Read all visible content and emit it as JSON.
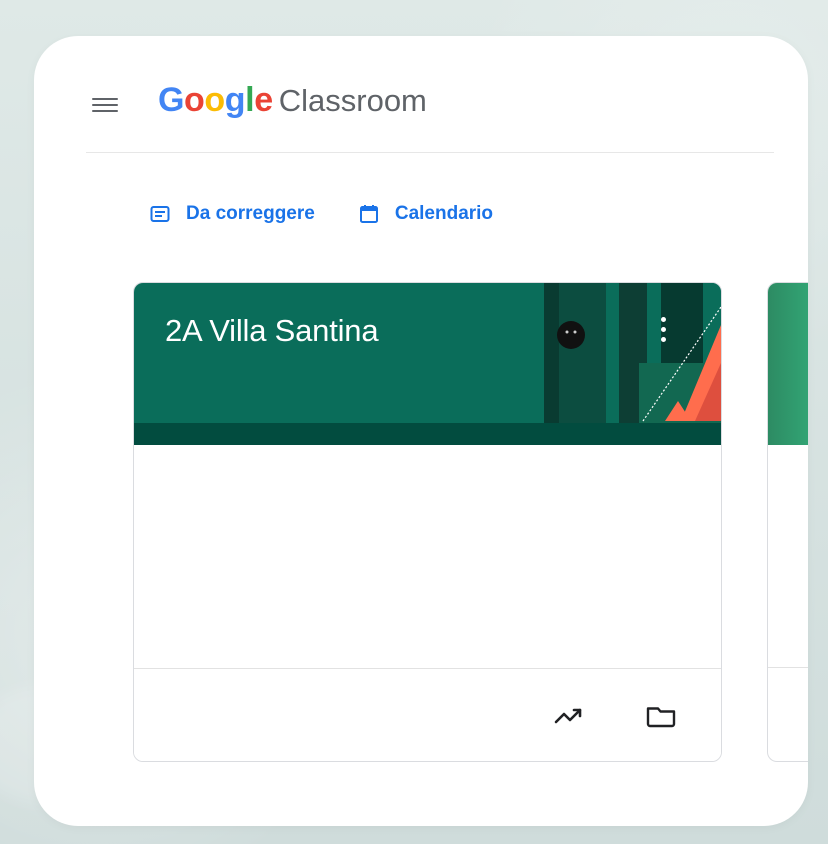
{
  "header": {
    "menu_icon": "menu-icon",
    "brand_google": "Google",
    "brand_product": "Classroom"
  },
  "actions": [
    {
      "label": "Da correggere",
      "icon": "assignment-icon"
    },
    {
      "label": "Calendario",
      "icon": "calendar-icon"
    }
  ],
  "course_card": {
    "title": "2A Villa Santina",
    "menu_icon": "more-vert-icon",
    "footer_icons": [
      "trending-up-icon",
      "folder-icon"
    ]
  },
  "colors": {
    "google_blue": "#4285f4",
    "google_red": "#ea4335",
    "google_yellow": "#fbbc05",
    "google_green": "#34a853",
    "action_blue": "#1a73e8",
    "course_header": "#0a6d5a",
    "course_strip": "#024c3f"
  }
}
